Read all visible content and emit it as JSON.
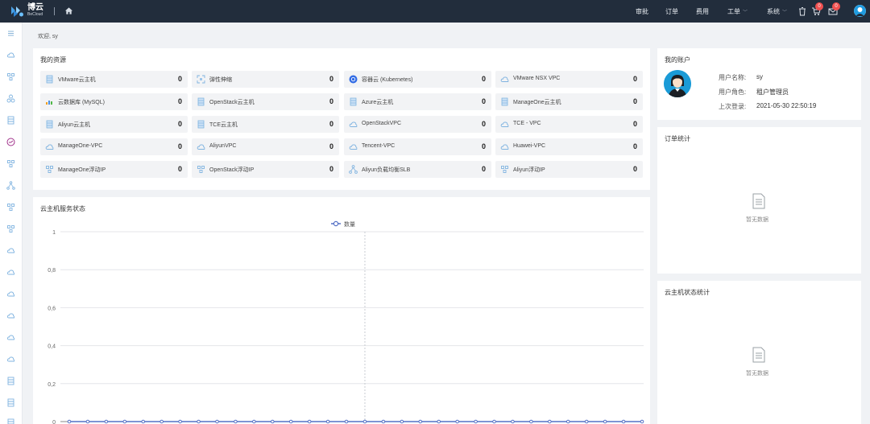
{
  "app": {
    "brand_cn": "博云",
    "brand_en": "BeCloud"
  },
  "nav": {
    "items": [
      {
        "label": "审批",
        "dropdown": false
      },
      {
        "label": "订单",
        "dropdown": false
      },
      {
        "label": "费用",
        "dropdown": false
      },
      {
        "label": "工单",
        "dropdown": true
      },
      {
        "label": "系统",
        "dropdown": true
      }
    ],
    "cart_badge": "0",
    "message_badge": "0"
  },
  "welcome": "欢迎, sy",
  "resources": {
    "title": "我的资源",
    "items": [
      {
        "name": "VMware云主机",
        "count": "0",
        "icon": "server-icon"
      },
      {
        "name": "弹性伸缩",
        "count": "0",
        "icon": "scale-icon"
      },
      {
        "name": "容器云 (Kubernetes)",
        "count": "0",
        "icon": "kubernetes-icon"
      },
      {
        "name": "VMware NSX VPC",
        "count": "0",
        "icon": "cloud-icon"
      },
      {
        "name": "云数据库 (MySQL)",
        "count": "0",
        "icon": "database-icon"
      },
      {
        "name": "OpenStack云主机",
        "count": "0",
        "icon": "server-icon"
      },
      {
        "name": "Azure云主机",
        "count": "0",
        "icon": "server-icon"
      },
      {
        "name": "ManageOne云主机",
        "count": "0",
        "icon": "server-icon"
      },
      {
        "name": "Aliyun云主机",
        "count": "0",
        "icon": "server-icon"
      },
      {
        "name": "TCE云主机",
        "count": "0",
        "icon": "server-icon"
      },
      {
        "name": "OpenStackVPC",
        "count": "0",
        "icon": "cloud-icon"
      },
      {
        "name": "TCE - VPC",
        "count": "0",
        "icon": "cloud-icon"
      },
      {
        "name": "ManageOne-VPC",
        "count": "0",
        "icon": "cloud-icon"
      },
      {
        "name": "AliyunVPC",
        "count": "0",
        "icon": "cloud-icon"
      },
      {
        "name": "Tencent-VPC",
        "count": "0",
        "icon": "cloud-icon"
      },
      {
        "name": "Huawei-VPC",
        "count": "0",
        "icon": "cloud-icon"
      },
      {
        "name": "ManageOne浮动IP",
        "count": "0",
        "icon": "network-icon"
      },
      {
        "name": "OpenStack浮动IP",
        "count": "0",
        "icon": "network-icon"
      },
      {
        "name": "Aliyun负载均衡SLB",
        "count": "0",
        "icon": "loadbalancer-icon"
      },
      {
        "name": "Aliyun浮动IP",
        "count": "0",
        "icon": "network-icon"
      }
    ]
  },
  "account": {
    "title": "我的账户",
    "rows": [
      {
        "label": "用户名称:",
        "value": "sy"
      },
      {
        "label": "用户角色:",
        "value": "租户管理员"
      },
      {
        "label": "上次登录:",
        "value": "2021-05-30 22:50:19"
      }
    ]
  },
  "orders": {
    "title": "订单统计",
    "empty": "暂无数据"
  },
  "vm_status": {
    "title": "云主机状态统计",
    "empty": "暂无数据"
  },
  "service": {
    "title": "云主机服务状态"
  },
  "chart_data": {
    "type": "line",
    "legend": [
      "数量"
    ],
    "legend_position": "top-center",
    "y_ticks": [
      "1",
      "0,8",
      "0,6",
      "0,4",
      "0,2",
      "0"
    ],
    "ylim": [
      0,
      1
    ],
    "grid": true,
    "series": [
      {
        "name": "数量",
        "values": [
          0,
          0,
          0,
          0,
          0,
          0,
          0,
          0,
          0,
          0,
          0,
          0,
          0,
          0,
          0,
          0,
          0,
          0,
          0,
          0,
          0,
          0,
          0,
          0,
          0,
          0,
          0,
          0,
          0,
          0,
          0,
          0
        ]
      }
    ],
    "color": "#5470c6"
  },
  "colors": {
    "topbar": "#222d3c",
    "accent": "#5470c6",
    "badge": "#f05050"
  }
}
